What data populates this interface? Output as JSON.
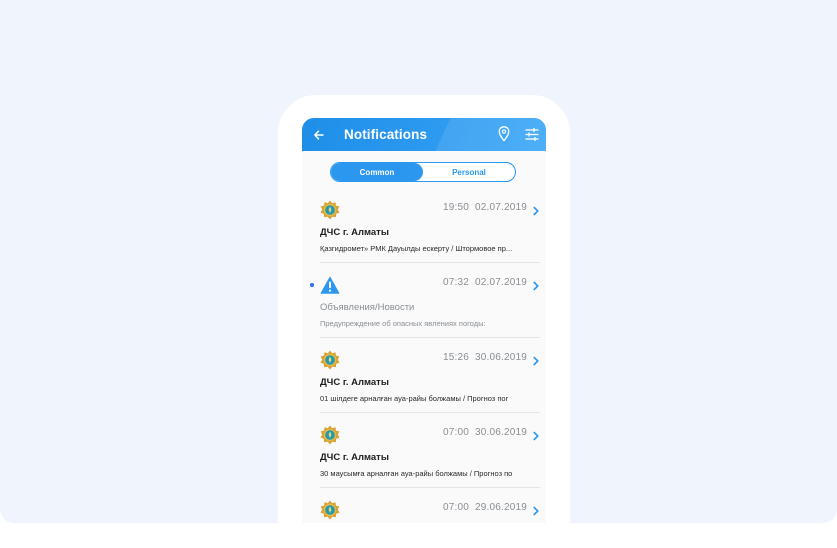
{
  "header": {
    "title": "Notifications",
    "icons": [
      "back-arrow-icon",
      "location-pin-icon",
      "filter-sliders-icon"
    ]
  },
  "tabs": [
    {
      "label": "Common",
      "selected": true
    },
    {
      "label": "Personal",
      "selected": false
    }
  ],
  "notifications": [
    {
      "time": "19:50",
      "date": "02.07.2019",
      "sender": "ДЧС г. Алматы",
      "preview": "Қазгидромет» РМК Дауылды ескерту / Штормовое пр...",
      "icon": "emblem-icon",
      "unread": false,
      "read_style": false
    },
    {
      "time": "07:32",
      "date": "02.07.2019",
      "sender": "Объявления/Новости",
      "preview": "Предупреждение об опасных явлениях погоды:",
      "icon": "warning-icon",
      "unread": true,
      "read_style": true
    },
    {
      "time": "15:26",
      "date": "30.06.2019",
      "sender": "ДЧС г. Алматы",
      "preview": "01 шілдеге арналған ауа-райы болжамы / Прогноз пог",
      "icon": "emblem-icon",
      "unread": false,
      "read_style": false
    },
    {
      "time": "07:00",
      "date": "30.06.2019",
      "sender": "ДЧС г. Алматы",
      "preview": "30 маусымға арналған ауа-райы болжамы / Прогноз по",
      "icon": "emblem-icon",
      "unread": false,
      "read_style": false
    },
    {
      "time": "07:00",
      "date": "29.06.2019",
      "sender": "",
      "preview": "",
      "icon": "emblem-icon",
      "unread": false,
      "read_style": false
    }
  ],
  "colors": {
    "accent": "#2b97ee",
    "unread_dot": "#2b6ae8",
    "emblem_gold": "#d9a032",
    "emblem_teal": "#1f9bb0"
  }
}
